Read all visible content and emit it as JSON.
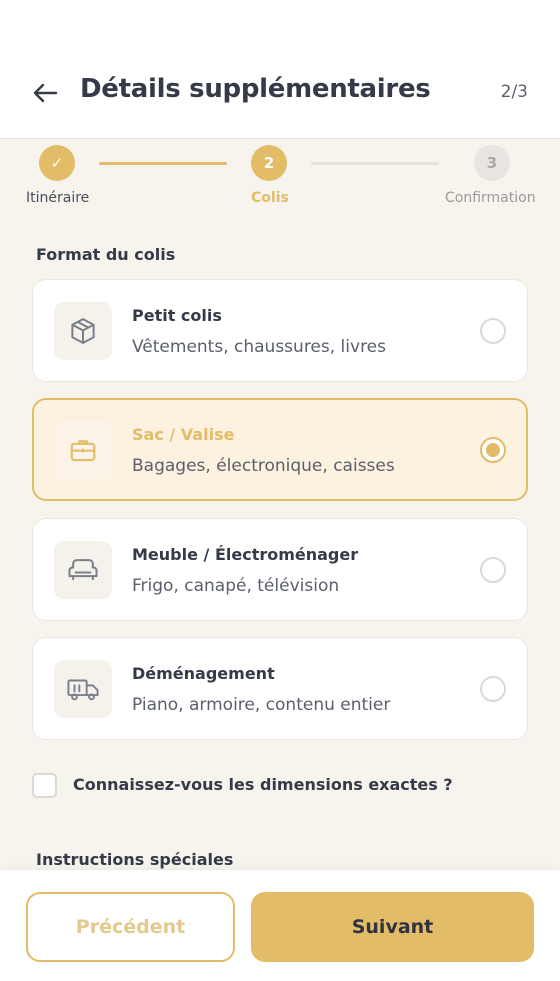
{
  "header": {
    "title": "Détails supplémentaires",
    "step_count": "2/3",
    "back_icon": "arrow-left-icon"
  },
  "stepper": {
    "steps": [
      {
        "number": "✓",
        "label": "Itinéraire",
        "state": "completed"
      },
      {
        "number": "2",
        "label": "Colis",
        "state": "active"
      },
      {
        "number": "3",
        "label": "Confirmation",
        "state": "upcoming"
      }
    ]
  },
  "format": {
    "title": "Format du colis",
    "options": [
      {
        "title": "Petit colis",
        "subtitle": "Vêtements, chaussures, livres",
        "icon": "box-icon",
        "selected": false
      },
      {
        "title": "Sac / Valise",
        "subtitle": "Bagages, électronique, caisses",
        "icon": "briefcase-icon",
        "selected": true
      },
      {
        "title": "Meuble / Électroménager",
        "subtitle": "Frigo, canapé, télévision",
        "icon": "armchair-icon",
        "selected": false
      },
      {
        "title": "Déménagement",
        "subtitle": "Piano, armoire, contenu entier",
        "icon": "truck-icon",
        "selected": false
      }
    ]
  },
  "dimensions": {
    "label": "Connaissez-vous les dimensions exactes ?",
    "checked": false
  },
  "special": {
    "title": "Instructions spéciales"
  },
  "footer": {
    "prev_label": "Précédent",
    "next_label": "Suivant"
  },
  "colors": {
    "accent": "#e3bc67",
    "selected_bg": "#fdf1e0",
    "text": "#353a48",
    "background": "#f7f4ee"
  }
}
